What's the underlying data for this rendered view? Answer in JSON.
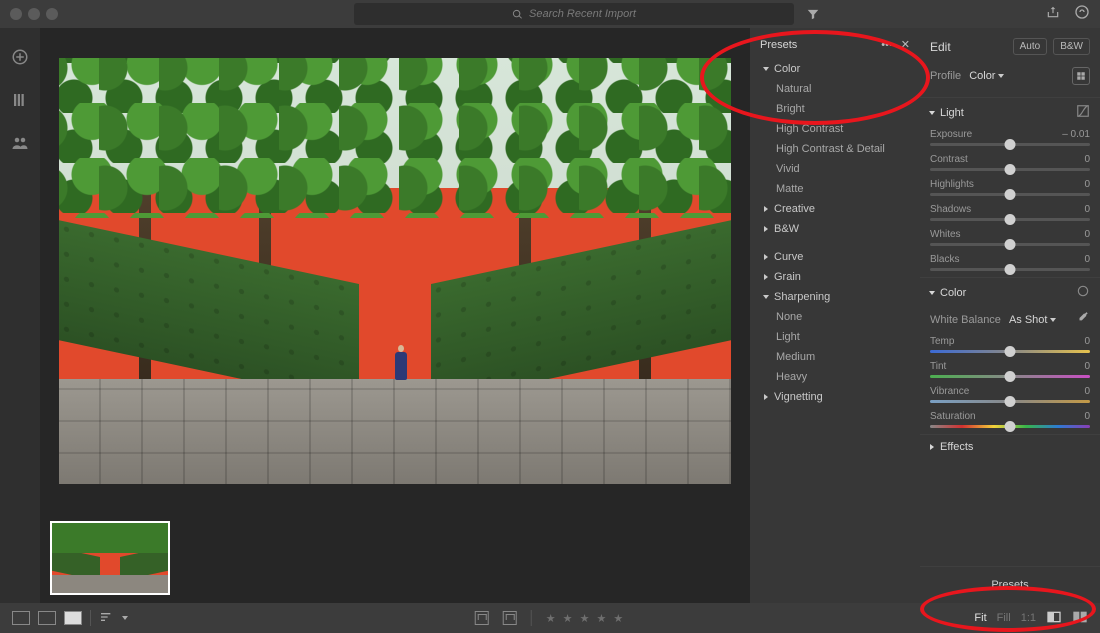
{
  "titlebar": {
    "search_placeholder": "Search Recent Import"
  },
  "presets": {
    "title": "Presets",
    "groups": {
      "color": {
        "label": "Color",
        "open": true
      },
      "creative": {
        "label": "Creative",
        "open": false
      },
      "bw": {
        "label": "B&W",
        "open": false
      },
      "curve": {
        "label": "Curve",
        "open": false
      },
      "grain": {
        "label": "Grain",
        "open": false
      },
      "sharpening": {
        "label": "Sharpening",
        "open": true
      },
      "vignetting": {
        "label": "Vignetting",
        "open": false
      }
    },
    "color_items": [
      "Natural",
      "Bright",
      "High Contrast",
      "High Contrast & Detail",
      "Vivid",
      "Matte"
    ],
    "sharpening_items": [
      "None",
      "Light",
      "Medium",
      "Heavy"
    ]
  },
  "edit": {
    "title": "Edit",
    "auto_label": "Auto",
    "bw_label": "B&W",
    "profile_label": "Profile",
    "profile_value": "Color",
    "sections": {
      "light": {
        "label": "Light"
      },
      "color": {
        "label": "Color"
      },
      "effects": {
        "label": "Effects"
      }
    },
    "light": {
      "exposure": {
        "label": "Exposure",
        "value": "– 0.01",
        "pos": 50
      },
      "contrast": {
        "label": "Contrast",
        "value": "0",
        "pos": 50
      },
      "highlights": {
        "label": "Highlights",
        "value": "0",
        "pos": 50
      },
      "shadows": {
        "label": "Shadows",
        "value": "0",
        "pos": 50
      },
      "whites": {
        "label": "Whites",
        "value": "0",
        "pos": 50
      },
      "blacks": {
        "label": "Blacks",
        "value": "0",
        "pos": 50
      }
    },
    "color": {
      "wb_label": "White Balance",
      "wb_value": "As Shot",
      "temp": {
        "label": "Temp",
        "value": "0",
        "pos": 50
      },
      "tint": {
        "label": "Tint",
        "value": "0",
        "pos": 50
      },
      "vibrance": {
        "label": "Vibrance",
        "value": "0",
        "pos": 50
      },
      "saturation": {
        "label": "Saturation",
        "value": "0",
        "pos": 50
      }
    },
    "presets_button": "Presets"
  },
  "footer": {
    "fit": "Fit",
    "fill": "Fill",
    "oneone": "1:1"
  }
}
